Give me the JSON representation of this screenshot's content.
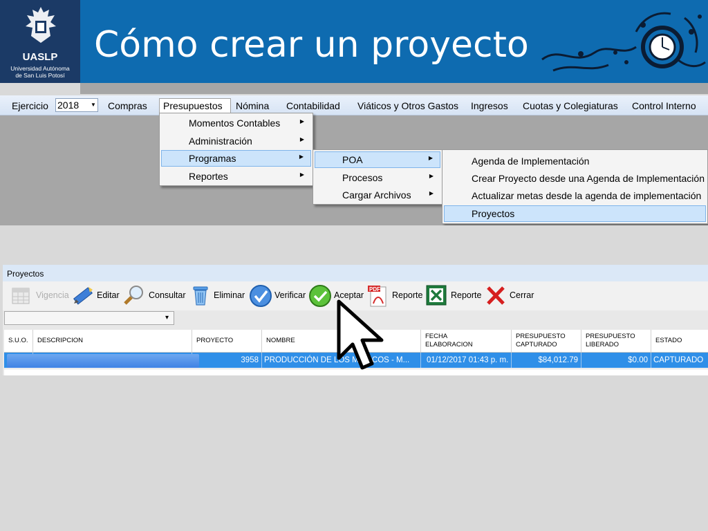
{
  "slide": {
    "title": "Cómo crear un proyecto",
    "logo": {
      "name": "UASLP",
      "subtitle_line1": "Universidad Autónoma",
      "subtitle_line2": "de San Luis Potosí"
    }
  },
  "menubar": {
    "ejercicio_label": "Ejercicio",
    "year": "2018",
    "items": [
      "Compras",
      "Presupuestos",
      "Nómina",
      "Contabilidad",
      "Viáticos y Otros Gastos",
      "Ingresos",
      "Cuotas y Colegiaturas",
      "Control Interno"
    ]
  },
  "presupuestos_menu": [
    "Momentos Contables",
    "Administración",
    "Programas",
    "Reportes"
  ],
  "programas_menu": [
    "POA",
    "Procesos",
    "Cargar Archivos"
  ],
  "poa_menu": [
    "Agenda de Implementación",
    "Crear Proyecto desde una Agenda de Implementación",
    "Actualizar metas desde la agenda de implementación",
    "Proyectos"
  ],
  "proyectos_window": {
    "title": "Proyectos",
    "toolbar": {
      "vigencia": "Vigencia",
      "editar": "Editar",
      "consultar": "Consultar",
      "eliminar": "Eliminar",
      "verificar": "Verificar",
      "aceptar": "Aceptar",
      "reporte_pdf": "Reporte",
      "reporte_excel": "Reporte",
      "cerrar": "Cerrar"
    },
    "grid": {
      "headers": {
        "suo": "S.U.O.",
        "descripcion": "DESCRIPCION",
        "proyecto": "PROYECTO",
        "nombre": "NOMBRE",
        "fecha_1": "FECHA",
        "fecha_2": "ELABORACION",
        "presupuesto_capturado_1": "PRESUPUESTO",
        "presupuesto_capturado_2": "CAPTURADO",
        "presupuesto_liberado_1": "PRESUPUESTO",
        "presupuesto_liberado_2": "LIBERADO",
        "estado": "ESTADO"
      },
      "row": {
        "proyecto": "3958",
        "nombre": "PRODUCCIÓN DE LOS MÉDICOS - M...",
        "fecha": "01/12/2017 01:43 p. m.",
        "presupuesto_capturado": "$84,012.79",
        "presupuesto_liberado": "$0.00",
        "estado": "CAPTURADO"
      }
    }
  },
  "icons": [
    "shield-logo",
    "calendar-icon",
    "edit-pencil-icon",
    "magnifier-icon",
    "trash-icon",
    "check-circle-icon",
    "green-check-icon",
    "pdf-icon",
    "excel-icon",
    "close-x-icon",
    "cursor-arrow"
  ]
}
